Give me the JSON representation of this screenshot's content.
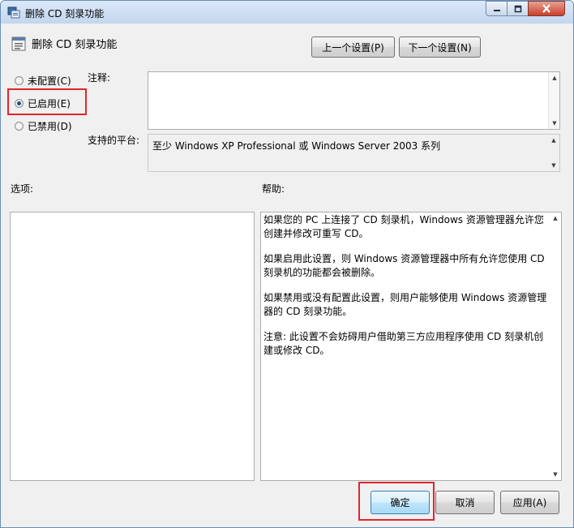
{
  "window": {
    "title": "删除 CD 刻录功能",
    "controls": {
      "minimize_icon": "minimize-icon",
      "maximize_icon": "maximize-icon",
      "close_icon": "close-icon"
    }
  },
  "header": {
    "title": "删除 CD 刻录功能"
  },
  "nav": {
    "prev": "上一个设置(P)",
    "next": "下一个设置(N)"
  },
  "state": {
    "options": [
      {
        "label": "未配置(C)",
        "checked": false
      },
      {
        "label": "已启用(E)",
        "checked": true
      },
      {
        "label": "已禁用(D)",
        "checked": false
      }
    ]
  },
  "comment": {
    "label": "注释:",
    "value": ""
  },
  "platform": {
    "label": "支持的平台:",
    "value": "至少 Windows XP Professional 或 Windows Server 2003 系列"
  },
  "options_pane": {
    "label": "选项:"
  },
  "help": {
    "label": "帮助:",
    "paragraphs": [
      "如果您的 PC 上连接了 CD 刻录机，Windows 资源管理器允许您创建并修改可重写 CD。",
      "如果启用此设置，则 Windows 资源管理器中所有允许您使用 CD 刻录机的功能都会被删除。",
      "如果禁用或没有配置此设置，则用户能够使用 Windows 资源管理器的 CD 刻录功能。",
      "注意: 此设置不会妨碍用户借助第三方应用程序使用 CD 刻录机创建或修改 CD。"
    ]
  },
  "footer": {
    "ok": "确定",
    "cancel": "取消",
    "apply": "应用(A)"
  },
  "colors": {
    "highlight": "#e0262a",
    "selected_dot": "#1d4e86"
  }
}
